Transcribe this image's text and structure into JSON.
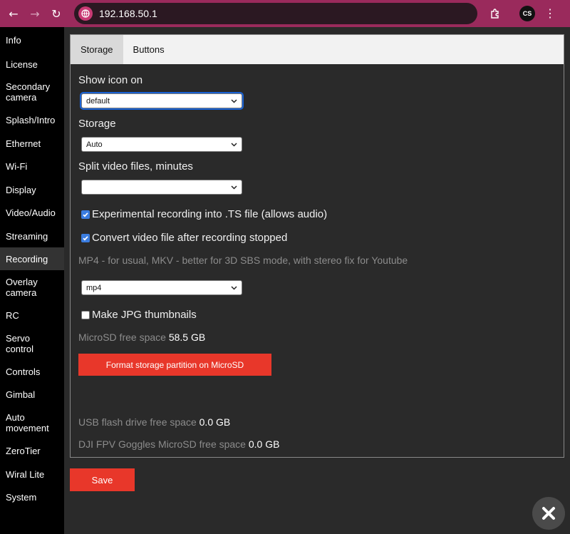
{
  "browser": {
    "url": "192.168.50.1",
    "profile_initials": "CS"
  },
  "sidebar": {
    "items": [
      {
        "label": "Info"
      },
      {
        "label": "License"
      },
      {
        "label": "Secondary camera"
      },
      {
        "label": "Splash/Intro"
      },
      {
        "label": "Ethernet"
      },
      {
        "label": "Wi-Fi"
      },
      {
        "label": "Display"
      },
      {
        "label": "Video/Audio"
      },
      {
        "label": "Streaming"
      },
      {
        "label": "Recording",
        "active": true
      },
      {
        "label": "Overlay camera"
      },
      {
        "label": "RC"
      },
      {
        "label": "Servo control"
      },
      {
        "label": "Controls"
      },
      {
        "label": "Gimbal"
      },
      {
        "label": "Auto movement"
      },
      {
        "label": "ZeroTier"
      },
      {
        "label": "Wiral Lite"
      },
      {
        "label": "System"
      }
    ]
  },
  "tabs": [
    {
      "label": "Storage",
      "active": true
    },
    {
      "label": "Buttons"
    }
  ],
  "form": {
    "show_icon_label": "Show icon on",
    "show_icon_value": "default",
    "storage_label": "Storage",
    "storage_value": "Auto",
    "split_label": "Split video files, minutes",
    "split_value": "",
    "ts_label": "Experimental recording into .TS file (allows audio)",
    "ts_checked": true,
    "convert_label": "Convert video file after recording stopped",
    "convert_checked": true,
    "format_hint": "MP4 - for usual, MKV - better for 3D SBS mode, with stereo fix for Youtube",
    "format_value": "mp4",
    "jpg_label": "Make JPG thumbnails",
    "jpg_checked": false,
    "microsd_label": "MicroSD free space",
    "microsd_value": "58.5 GB",
    "format_button": "Format storage partition on MicroSD",
    "usb_label": "USB flash drive free space",
    "usb_value": "0.0 GB",
    "dji_label": "DJI FPV Goggles MicroSD free space",
    "dji_value": "0.0 GB"
  },
  "save_label": "Save",
  "colors": {
    "accent_red": "#e8372a",
    "chrome": "#9a2a5c",
    "checkbox_blue": "#3b7de0"
  }
}
